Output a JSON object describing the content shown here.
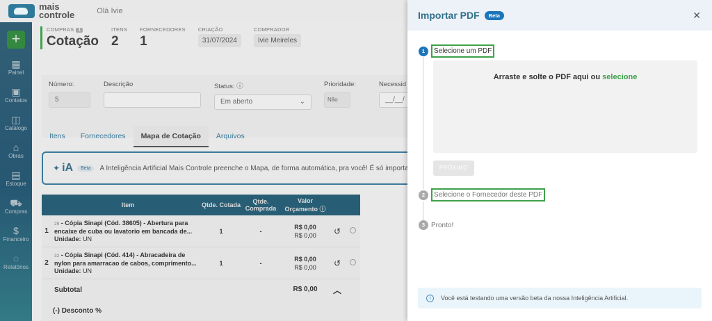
{
  "app": {
    "logo_line1": "mais",
    "logo_line2": "controle",
    "greeting": "Olá Ivie"
  },
  "sidebar": {
    "new_icon": "plus-icon",
    "items": [
      {
        "label": "Painel",
        "icon": "dashboard-icon"
      },
      {
        "label": "Contatos",
        "icon": "contacts-icon"
      },
      {
        "label": "Catálogo",
        "icon": "catalog-icon"
      },
      {
        "label": "Obras",
        "icon": "obras-icon"
      },
      {
        "label": "Estoque",
        "icon": "stock-icon"
      },
      {
        "label": "Compras",
        "icon": "cart-icon"
      },
      {
        "label": "Financeiro",
        "icon": "dollar-icon"
      },
      {
        "label": "Relatórios",
        "icon": "reports-icon"
      }
    ]
  },
  "header": {
    "compras_label": "COMPRAS",
    "compras_badge": "1",
    "title": "Cotação",
    "itens_label": "ITENS",
    "itens_value": "2",
    "fornecedores_label": "FORNECEDORES",
    "fornecedores_value": "1",
    "criacao_label": "CRIAÇÃO",
    "criacao_value": "31/07/2024",
    "comprador_label": "COMPRADOR",
    "comprador_value": "Ivie Meireles"
  },
  "form": {
    "numero_label": "Número:",
    "numero_value": "5",
    "descricao_label": "Descrição",
    "descricao_value": "",
    "status_label": "Status:",
    "status_value": "Em aberto",
    "prioridade_label": "Prioridade:",
    "prioridade_value": "Não",
    "necessidade_label": "Necessid",
    "necessidade_value": "__/__/"
  },
  "tabs": [
    "Itens",
    "Fornecedores",
    "Mapa de Cotação",
    "Arquivos"
  ],
  "ia_banner": {
    "logo": "iA",
    "beta": "Beta",
    "text": "A Inteligência Artificial Mais Controle preenche o Mapa, de forma automática, pra você! É só importar os o"
  },
  "table": {
    "headers": {
      "item": "Item",
      "qtde_cotada": "Qtde. Cotada",
      "qtde_comprada": "Qtde. Comprada",
      "valor": "Valor Orçamento"
    },
    "rows": [
      {
        "num": "1",
        "code": "29",
        "desc": " - Cópia Sinapi (Cód. 38605) - Abertura para encaixe de cuba ou lavatorio em bancada de...",
        "unidade_label": "Unidade:",
        "unidade": "UN",
        "qtde_cotada": "1",
        "qtde_comprada": "-",
        "valor1": "R$ 0,00",
        "valor2": "R$ 0,00"
      },
      {
        "num": "2",
        "code": "32",
        "desc": " - Cópia Sinapi (Cód. 414) - Abracadeira de nylon para amarracao de cabos, comprimento...",
        "unidade_label": "Unidade:",
        "unidade": "UN",
        "qtde_cotada": "1",
        "qtde_comprada": "-",
        "valor1": "R$ 0,00",
        "valor2": "R$ 0,00"
      }
    ],
    "subtotal_label": "Subtotal",
    "subtotal_value": "R$ 0,00",
    "desconto_label": "(-) Desconto %"
  },
  "modal": {
    "title": "Importar PDF",
    "beta": "Beta",
    "close_icon": "close-icon",
    "step1_num": "1",
    "step1_label": "Selecione um PDF",
    "dropzone_text": "Arraste e solte o PDF aqui ou ",
    "dropzone_link": "selecione",
    "next_button": "PRÓXIMO",
    "step2_num": "2",
    "step2_label": "Selecione o Fornecedor deste PDF",
    "step3_num": "3",
    "step3_label": "Pronto!",
    "info_text": "Você está testando uma versão beta da nossa Inteligência Artificial."
  }
}
